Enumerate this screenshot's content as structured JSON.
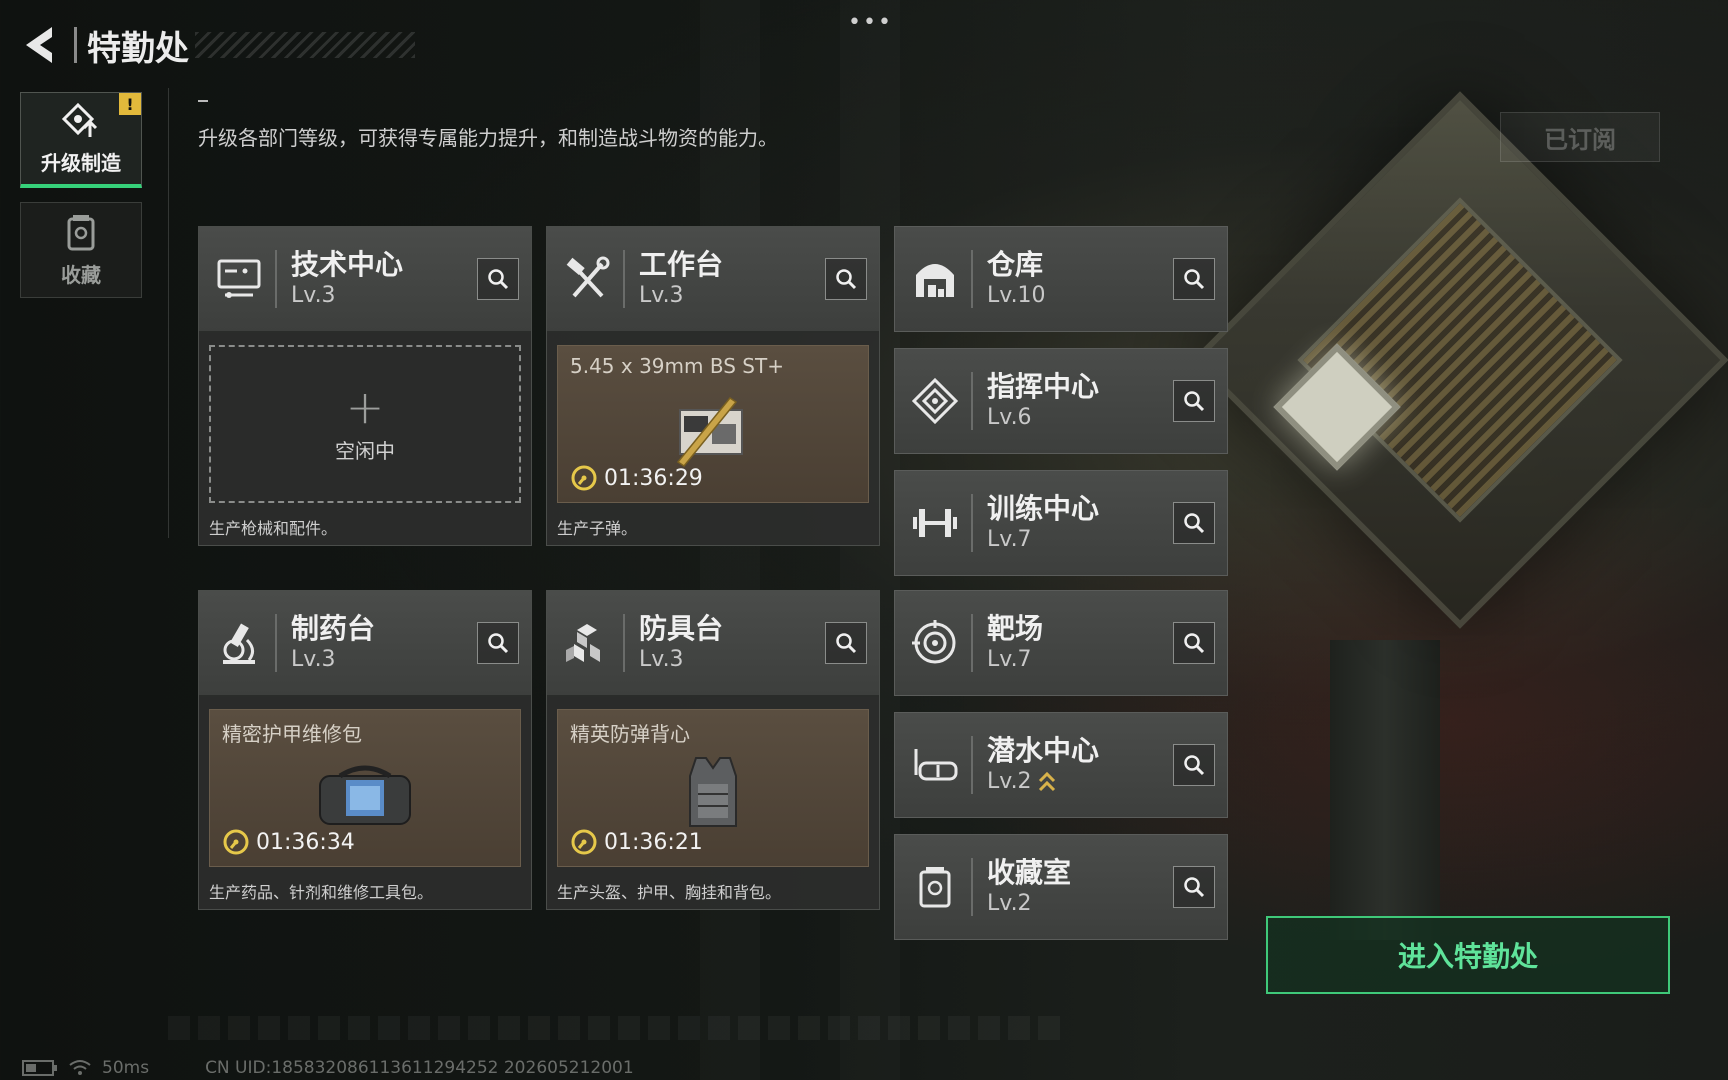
{
  "header": {
    "title": "特勤处",
    "more": "•••"
  },
  "nav": {
    "items": [
      {
        "label": "升级制造",
        "active": true,
        "badge": "!"
      },
      {
        "label": "收藏",
        "active": false
      }
    ]
  },
  "intro": "升级各部门等级，可获得专属能力提升，和制造战斗物资的能力。",
  "subscribed": "已订阅",
  "workstations": [
    {
      "name": "技术中心",
      "level": "Lv.3",
      "status": "idle",
      "idle_text": "空闲中",
      "desc": "生产枪械和配件。"
    },
    {
      "name": "工作台",
      "level": "Lv.3",
      "status": "producing",
      "product": "5.45 x 39mm BS ST+",
      "timer": "01:36:29",
      "desc": "生产子弹。"
    },
    {
      "name": "制药台",
      "level": "Lv.3",
      "status": "producing",
      "product": "精密护甲维修包",
      "timer": "01:36:34",
      "desc": "生产药品、针剂和维修工具包。"
    },
    {
      "name": "防具台",
      "level": "Lv.3",
      "status": "producing",
      "product": "精英防弹背心",
      "timer": "01:36:21",
      "desc": "生产头盔、护甲、胸挂和背包。"
    }
  ],
  "facilities": [
    {
      "name": "仓库",
      "level": "Lv.10",
      "icon": "warehouse-icon"
    },
    {
      "name": "指挥中心",
      "level": "Lv.6",
      "icon": "command-icon"
    },
    {
      "name": "训练中心",
      "level": "Lv.7",
      "icon": "dumbbell-icon"
    },
    {
      "name": "靶场",
      "level": "Lv.7",
      "icon": "target-icon"
    },
    {
      "name": "潜水中心",
      "level": "Lv.2",
      "icon": "diving-mask-icon",
      "upgradable": true
    },
    {
      "name": "收藏室",
      "level": "Lv.2",
      "icon": "collection-icon"
    }
  ],
  "enter_button": "进入特勤处",
  "footer": {
    "ping": "50ms",
    "uid": "CN UID:18583208611361129​4252 202605212001"
  },
  "colors": {
    "accent_green": "#3fc979",
    "badge_yellow": "#e2b93b",
    "timer_yellow": "#e6c84a",
    "product_bg": "#4a3f33"
  }
}
